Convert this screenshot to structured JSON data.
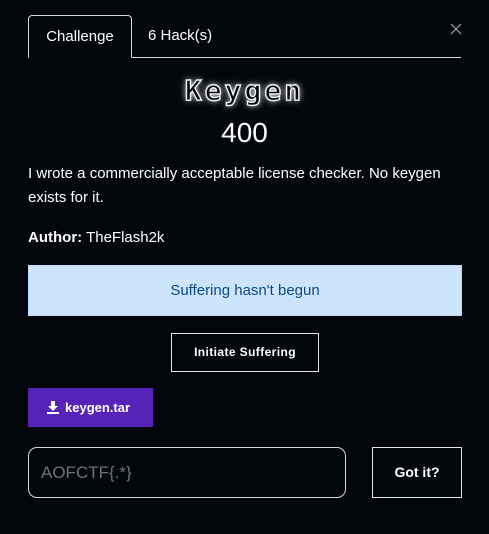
{
  "tabs": [
    {
      "label": "Challenge",
      "active": true
    },
    {
      "label": "6 Hack(s)",
      "active": false
    }
  ],
  "close_icon": "close-icon",
  "challenge": {
    "name": "Keygen",
    "points": "400",
    "description": "I wrote a commercially acceptable license checker. No keygen exists for it.",
    "author_label": "Author:",
    "author": "TheFlash2k"
  },
  "status": {
    "text": "Suffering hasn't begun",
    "background": "#cce5fc",
    "text_color": "#0c4a86"
  },
  "initiate_button": "Initiate Suffering",
  "download": {
    "icon": "download-icon",
    "label": "keygen.tar",
    "color": "#5523b5"
  },
  "flag_input": {
    "value": "",
    "placeholder": "AOFCTF{.*}"
  },
  "submit_button": "Got it?"
}
